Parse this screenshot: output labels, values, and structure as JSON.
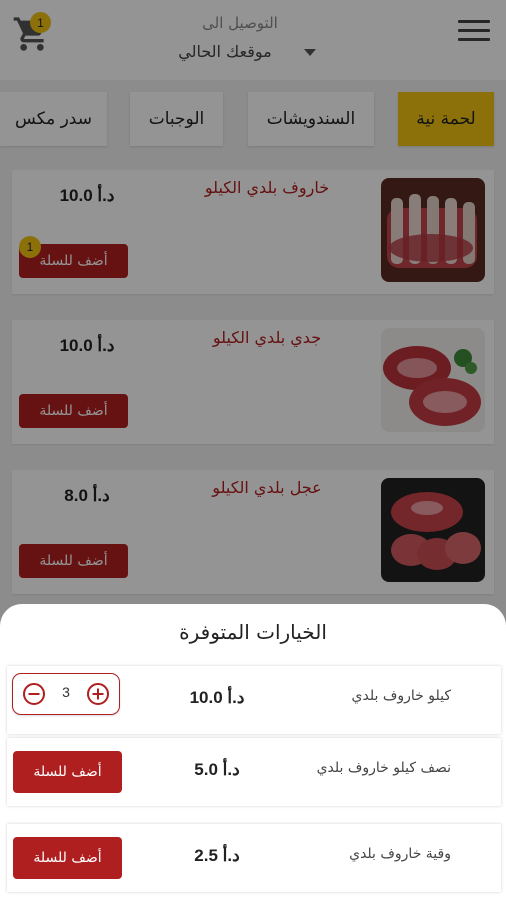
{
  "header": {
    "deliver_label": "التوصيل الى",
    "location": "موقعك الحالي",
    "cart_count": "1"
  },
  "tabs": [
    {
      "label": "لحمة نية",
      "active": true
    },
    {
      "label": "السندويشات",
      "active": false
    },
    {
      "label": "الوجبات",
      "active": false
    },
    {
      "label": "سدر مكس",
      "active": false
    }
  ],
  "products": [
    {
      "name": "خاروف بلدي الكيلو",
      "price": "10.0 د.أ",
      "button": "أضف للسلة",
      "badge": "1"
    },
    {
      "name": "جدي بلدي الكيلو",
      "price": "10.0 د.أ",
      "button": "أضف للسلة"
    },
    {
      "name": "عجل بلدي  الكيلو",
      "price": "8.0 د.أ",
      "button": "أضف للسلة"
    }
  ],
  "sheet": {
    "title": "الخيارات المتوفرة",
    "options": [
      {
        "name": "كيلو خاروف بلدي",
        "price": "10.0 د.أ",
        "quantity": "3"
      },
      {
        "name": "نصف كيلو خاروف بلدي",
        "price": "5.0 د.أ",
        "button": "أضف للسلة"
      },
      {
        "name": "وقية خاروف بلدي",
        "price": "2.5 د.أ",
        "button": "أضف للسلة"
      }
    ]
  },
  "colors": {
    "accent_yellow": "#f2c314",
    "brand_red": "#b01f1f",
    "overlay": "rgba(0,0,0,0.42)"
  },
  "icons": [
    "cart-icon",
    "menu-icon",
    "chevron-down-icon",
    "minus-circle-icon",
    "plus-circle-icon"
  ]
}
